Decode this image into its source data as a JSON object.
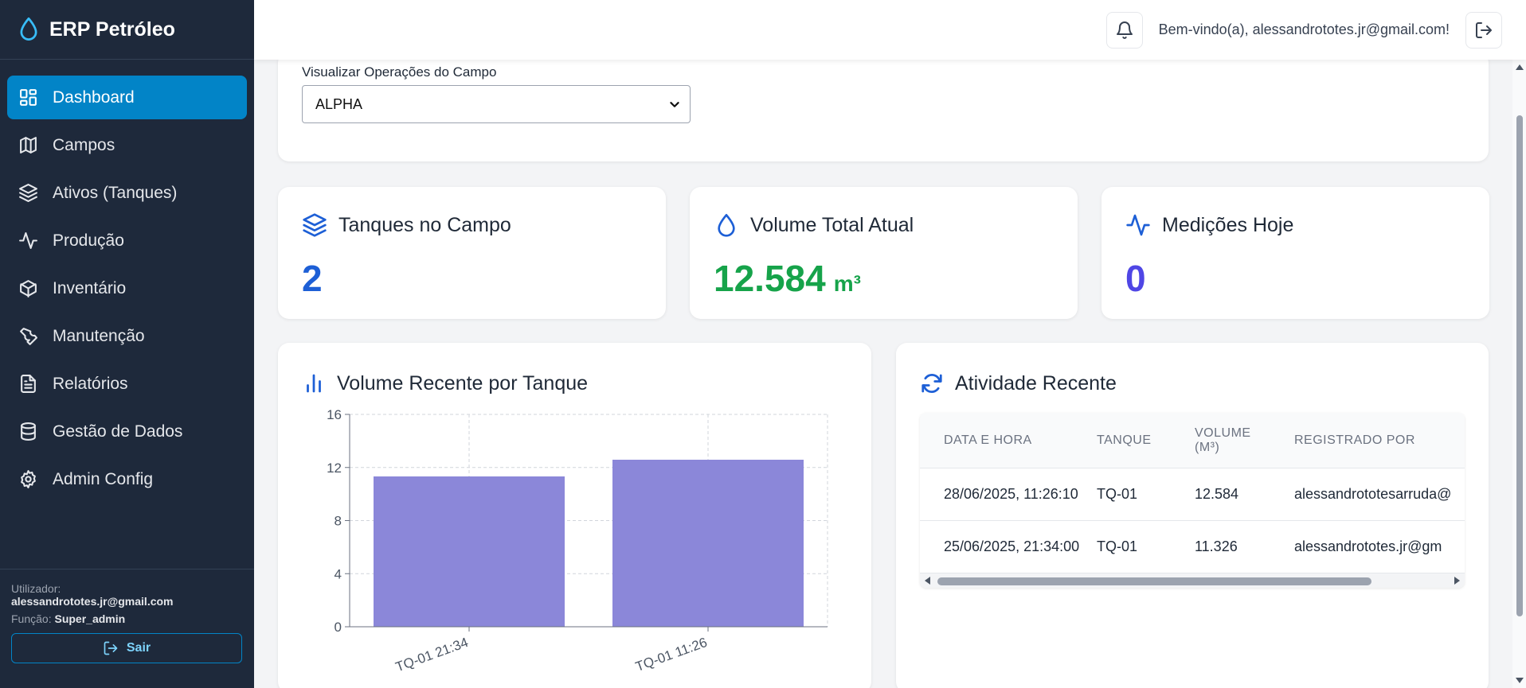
{
  "app": {
    "title": "ERP Petróleo"
  },
  "sidebar": {
    "items": [
      {
        "label": "Dashboard",
        "icon": "dashboard-icon",
        "active": true
      },
      {
        "label": "Campos",
        "icon": "map-icon"
      },
      {
        "label": "Ativos (Tanques)",
        "icon": "layers-icon"
      },
      {
        "label": "Produção",
        "icon": "activity-icon"
      },
      {
        "label": "Inventário",
        "icon": "package-icon"
      },
      {
        "label": "Manutenção",
        "icon": "wrench-icon"
      },
      {
        "label": "Relatórios",
        "icon": "file-text-icon"
      },
      {
        "label": "Gestão de Dados",
        "icon": "database-icon"
      },
      {
        "label": "Admin Config",
        "icon": "gear-icon"
      }
    ],
    "footer": {
      "user_label": "Utilizador:",
      "user_email": "alessandrototes.jr@gmail.com",
      "role_label": "Função:",
      "role_value": "Super_admin",
      "logout_label": "Sair"
    }
  },
  "header": {
    "welcome": "Bem-vindo(a), alessandrototes.jr@gmail.com!"
  },
  "field_selector": {
    "label": "Visualizar Operações do Campo",
    "value": "ALPHA"
  },
  "stats": [
    {
      "title": "Tanques no Campo",
      "value": "2",
      "unit": "",
      "color": "#1d5fd6",
      "icon": "layers-icon"
    },
    {
      "title": "Volume Total Atual",
      "value": "12.584",
      "unit": "m³",
      "color": "#16a34a",
      "icon": "droplet-icon"
    },
    {
      "title": "Medições Hoje",
      "value": "0",
      "unit": "",
      "color": "#4f46e5",
      "icon": "activity-icon"
    }
  ],
  "chart_card": {
    "title": "Volume Recente por Tanque"
  },
  "chart_data": {
    "type": "bar",
    "categories": [
      "TQ-01 21:34",
      "TQ-01 11:26"
    ],
    "values": [
      11.326,
      12.584
    ],
    "ylim": [
      0,
      16
    ],
    "yticks": [
      0,
      4,
      8,
      12,
      16
    ],
    "grid": true,
    "bar_color": "#8b87d9"
  },
  "activity": {
    "title": "Atividade Recente",
    "columns": [
      "DATA E HORA",
      "TANQUE",
      "VOLUME (M³)",
      "REGISTRADO POR"
    ],
    "rows": [
      [
        "28/06/2025, 11:26:10",
        "TQ-01",
        "12.584",
        "alessandrototesarruda@"
      ],
      [
        "25/06/2025, 21:34:00",
        "TQ-01",
        "11.326",
        "alessandrototes.jr@gm"
      ]
    ]
  }
}
